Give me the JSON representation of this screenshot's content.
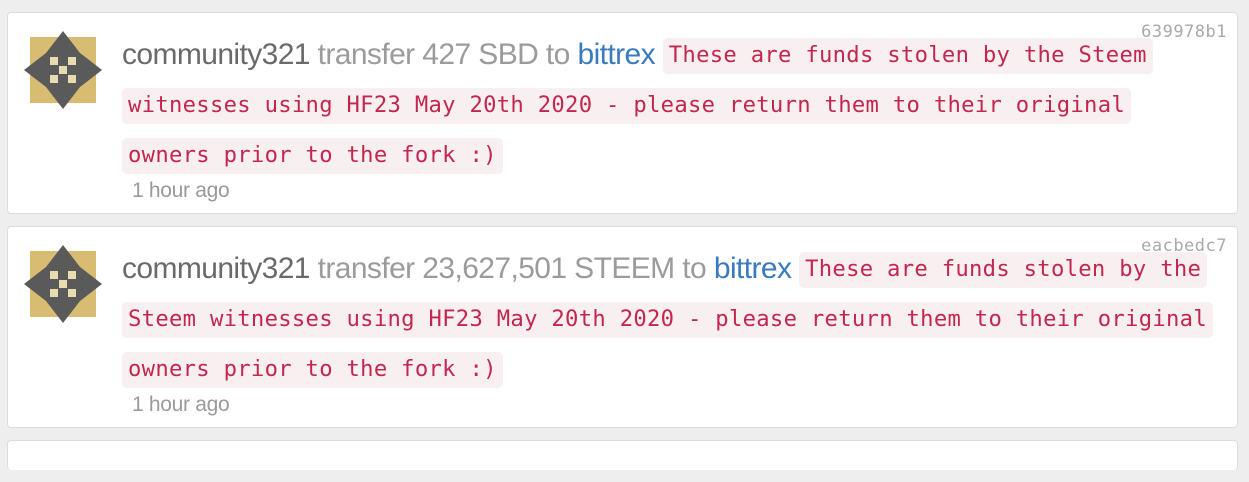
{
  "transfers": [
    {
      "tx_id": "639978b1",
      "from": "community321",
      "action": "transfer",
      "amount": "427 SBD",
      "to_word": "to",
      "to": "bittrex",
      "memo": "These are funds stolen by the Steem witnesses using HF23 May 20th 2020 - please return them to their original owners prior to the fork :)",
      "time": "1 hour ago"
    },
    {
      "tx_id": "eacbedc7",
      "from": "community321",
      "action": "transfer",
      "amount": "23,627,501 STEEM",
      "to_word": "to",
      "to": "bittrex",
      "memo": "These are funds stolen by the Steem witnesses using HF23 May 20th 2020 - please return them to their original owners prior to the fork :)",
      "time": "1 hour ago"
    }
  ],
  "avatar_icon": "identicon-avatar-icon",
  "colors": {
    "username": "#6a6a6a",
    "link": "#3a7bbf",
    "memo_text": "#c3274f",
    "memo_bg": "#f8eff1",
    "avatar_gold": "#d8bc72",
    "avatar_dark": "#5a5a5a"
  }
}
